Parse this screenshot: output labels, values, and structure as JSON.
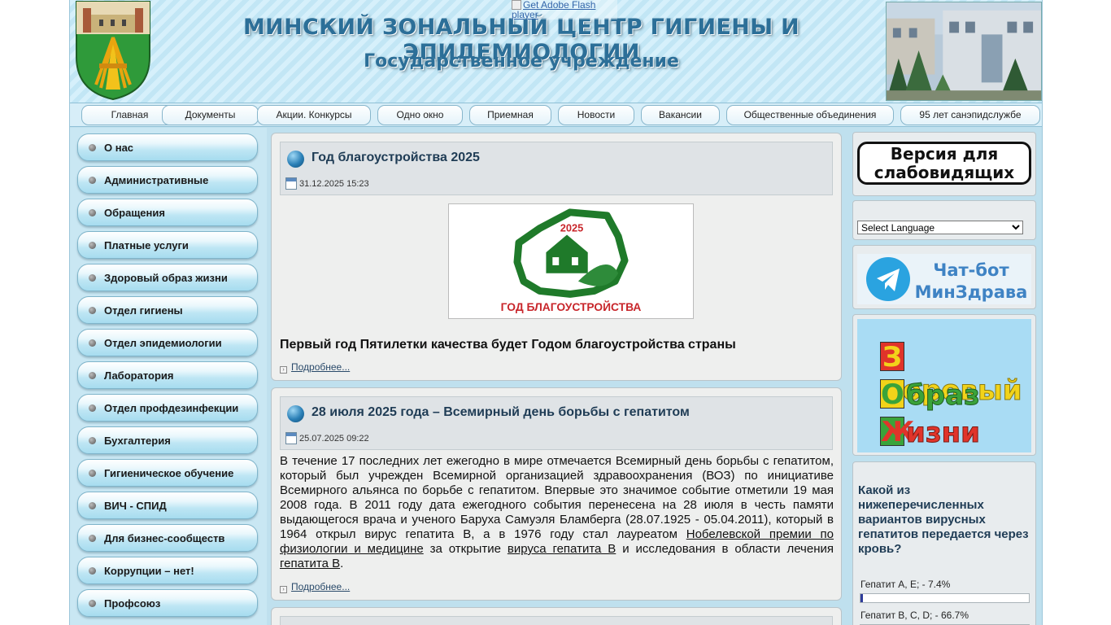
{
  "header": {
    "title": "МИНСКИЙ ЗОНАЛЬНЫЙ ЦЕНТР ГИГИЕНЫ И ЭПИДЕМИОЛОГИИ",
    "subtitle": "Государственное учреждение",
    "flash_alt": "Get Adobe Flash player"
  },
  "topnav": [
    {
      "label": "Главная"
    },
    {
      "label": "Документы"
    },
    {
      "label": "Акции. Конкурсы"
    },
    {
      "label": "Одно окно"
    },
    {
      "label": "Приемная"
    },
    {
      "label": "Новости"
    },
    {
      "label": "Вакансии"
    },
    {
      "label": "Общественные объединения"
    },
    {
      "label": "95 лет санэпидслужбе"
    }
  ],
  "leftmenu": [
    {
      "label": "О нас"
    },
    {
      "label": "Административные"
    },
    {
      "label": "Обращения"
    },
    {
      "label": "Платные услуги"
    },
    {
      "label": "Здоровый образ жизни"
    },
    {
      "label": "Отдел гигиены"
    },
    {
      "label": "Отдел эпидемиологии"
    },
    {
      "label": "Лаборатория"
    },
    {
      "label": "Отдел профдезинфекции"
    },
    {
      "label": "Бухгалтерия"
    },
    {
      "label": "Гигиеническое обучение"
    },
    {
      "label": "ВИЧ - СПИД"
    },
    {
      "label": "Для бизнес-сообществ"
    },
    {
      "label": "Коррупции – нет!"
    },
    {
      "label": "Профсоюз"
    }
  ],
  "articles": [
    {
      "title": "Год благоустройства 2025",
      "date": "31.12.2025 15:23",
      "image_year": "2025",
      "image_caption": "ГОД БЛАГОУСТРОЙСТВА",
      "lead": "Первый год Пятилетки качества будет Годом благоустройства страны",
      "more": "Подробнее..."
    },
    {
      "title": "28 июля 2025 года – Всемирный день борьбы с гепатитом",
      "date": "25.07.2025 09:22",
      "body_1": "В течение 17 последних лет ежегодно в мире отмечается Всемирный день борьбы с гепатитом, который был учрежден Всемирной организацией здравоохранения (ВОЗ) по инициативе Всемирного альянса по борьбе с гепатитом. Впервые это значимое событие отметили 19 мая 2008 года. В 2011 году дата ежегодного события перенесена на 28 июля в честь  памяти выдающегося врача и ученого Баруха Самуэля Бламберга (28.07.1925 - 05.04.2011), который в 1964 открыл вирус гепатита B, а в 1976 году стал лауреатом ",
      "link_1": "Нобелевской премии по физиологии и медицине",
      "body_2": " за открытие ",
      "link_2": "вируса гепатита B",
      "body_3": " и исследования в области лечения ",
      "link_3": "гепатита B",
      "body_4": ".",
      "more": "Подробнее..."
    }
  ],
  "right": {
    "low_vision_label": "Версия для слабовидящих",
    "language_select": "Select Language",
    "chatbot_line1": "Чат-бот",
    "chatbot_line2": "МинЗдрава",
    "zozh": [
      {
        "cap": "З",
        "rest": "доровый"
      },
      {
        "cap": "О",
        "rest": "браз"
      },
      {
        "cap": "Ж",
        "rest": "изни"
      }
    ],
    "poll": {
      "question": "Какой из нижеперечисленных вариантов вирусных гепатитов передается через кровь?",
      "options": [
        {
          "label": "Гепатит А, Е; - 7.4%",
          "percent": 7.4
        },
        {
          "label": "Гепатит В, С, D; - 66.7%",
          "percent": 66.7
        }
      ]
    }
  },
  "colors": {
    "title_blue": "#2c6f98",
    "zozh_red": "#e0342a",
    "zozh_yellow": "#f2d31a",
    "zozh_green": "#3aa33a",
    "poll_fill": "#2e3c9a",
    "logo_green": "#1f7a2a"
  }
}
